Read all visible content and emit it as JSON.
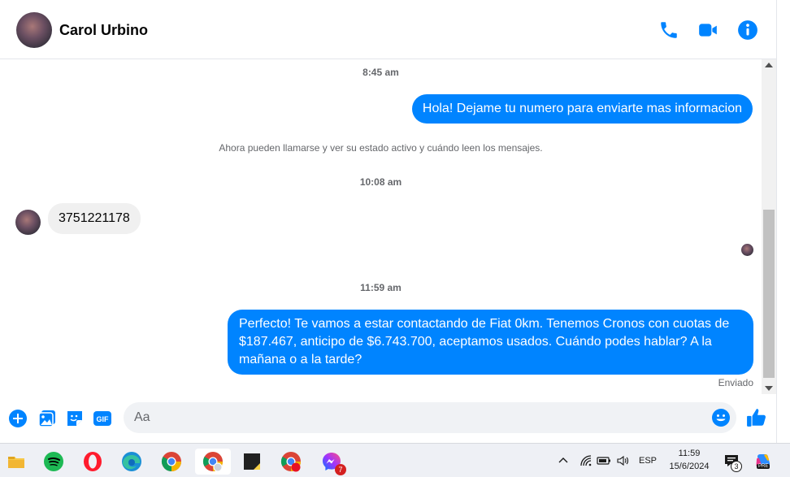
{
  "header": {
    "contact_name": "Carol Urbino",
    "icons": [
      "phone-icon",
      "video-camera-icon",
      "info-icon"
    ],
    "accent_color": "#0084ff"
  },
  "chat": {
    "timestamps": [
      "8:45 am",
      "10:08 am",
      "11:59 am"
    ],
    "system_notice": "Ahora pueden llamarse y ver su estado activo y cuándo leen los mensajes.",
    "messages": [
      {
        "direction": "outgoing",
        "text": "Hola! Dejame tu numero para enviarte mas informacion"
      },
      {
        "direction": "incoming",
        "text": "3751221178"
      },
      {
        "direction": "outgoing",
        "text": "Perfecto! Te vamos a estar contactando de Fiat 0km. Tenemos Cronos con cuotas de $187.467, anticipo de $6.743.700, aceptamos usados. Cuándo podes hablar? A la mañana o a la tarde?"
      }
    ],
    "status": "Enviado"
  },
  "composer": {
    "placeholder": "Aa",
    "gif_label": "GIF",
    "icons": [
      "plus-icon",
      "image-icon",
      "sticker-icon",
      "gif-icon",
      "emoji-icon",
      "thumbs-up-icon"
    ]
  },
  "taskbar": {
    "apps": [
      "file-explorer-icon",
      "spotify-icon",
      "opera-icon",
      "edge-icon",
      "chrome-icon",
      "chrome-profile-icon",
      "sticky-notes-icon",
      "chrome-red-icon",
      "messenger-icon"
    ],
    "messenger_badge": "7",
    "language": "ESP",
    "time": "11:59",
    "date": "15/6/2024",
    "notification_count": "3",
    "copilot_badge": "PRE"
  }
}
